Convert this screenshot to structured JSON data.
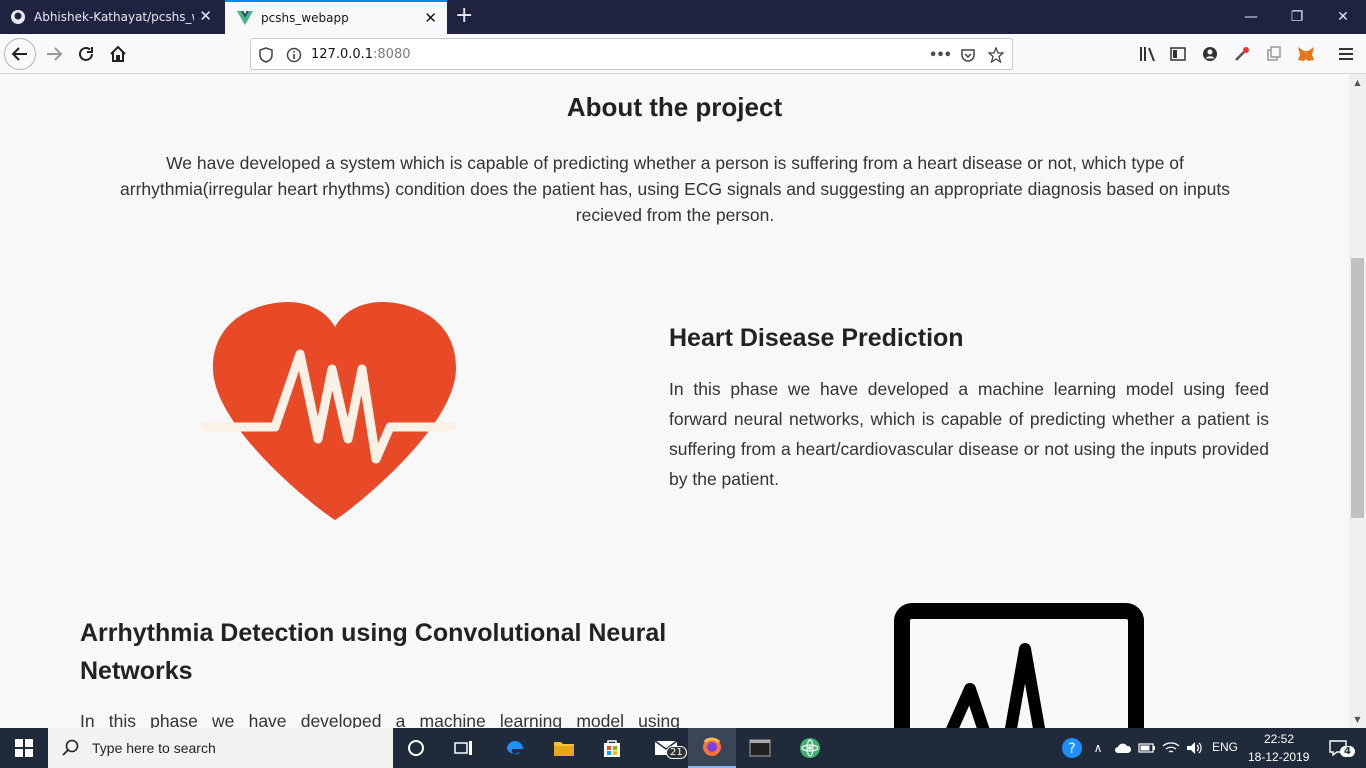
{
  "browser": {
    "tabs": [
      {
        "label": "Abhishek-Kathayat/pcshs_web",
        "active": false
      },
      {
        "label": "pcshs_webapp",
        "active": true
      }
    ],
    "new_tab": "+",
    "url_host": "127.0.0.1",
    "url_port": ":8080",
    "url_more": "•••"
  },
  "page": {
    "about": {
      "title": "About the project",
      "text": "We have developed a system which is capable of predicting whether a person is suffering from a heart disease or not, which type of arrhythmia(irregular heart rhythms) condition does the patient has, using ECG signals and suggesting an appropriate diagnosis based on inputs recieved from the person."
    },
    "heart_disease": {
      "title": "Heart Disease Prediction",
      "text": "In this phase we have developed a machine learning model using feed forward neural networks, which is capable of predicting whether a patient is suffering from a heart/cardiovascular disease or not using the inputs provided by the patient.",
      "icon": "heart-ecg-icon"
    },
    "arrhythmia": {
      "title": "Arrhythmia Detection using Convolutional Neural Networks",
      "text": "In this phase we have developed a machine learning model using",
      "icon": "ecg-monitor-icon"
    }
  },
  "taskbar": {
    "search_placeholder": "Type here to search",
    "mail_badge": "21",
    "language": "ENG",
    "time": "22:52",
    "date": "18-12-2019",
    "notification_count": "4"
  },
  "colors": {
    "heart": "#e84a27",
    "ecg_line": "#faf1e6",
    "tabbar": "#202340",
    "taskbar": "#1f2b3a"
  }
}
